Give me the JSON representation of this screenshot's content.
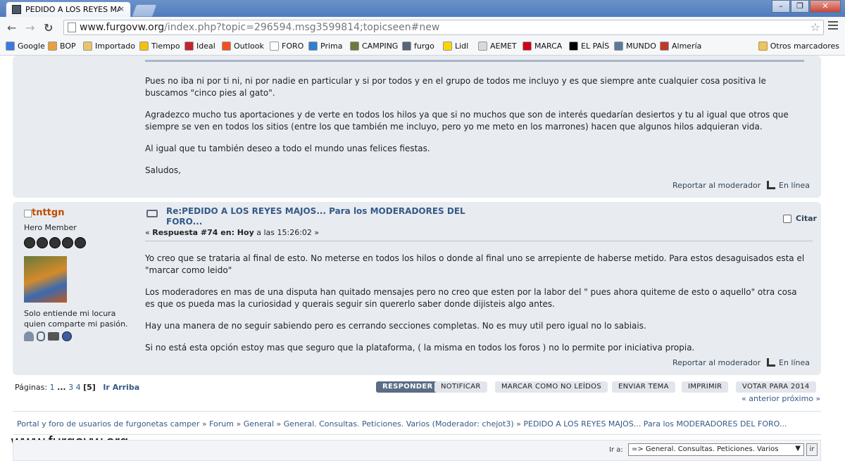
{
  "browser": {
    "tab_title": "PEDIDO A LOS REYES MAJOS...",
    "tab_close": "×",
    "url_main": "www.furgovw.org",
    "url_rest": "/index.php?topic=296594.msg3599814;topicseen#new",
    "star": "☆",
    "back": "←",
    "forward": "→",
    "reload": "↻",
    "win_min": "–",
    "win_max": "❐",
    "win_close": "✕"
  },
  "bookmarks": {
    "items": [
      {
        "label": "Google",
        "color": "#3b7ae0"
      },
      {
        "label": "BOP",
        "color": "#e9a23b"
      },
      {
        "label": "Importado",
        "color": "#e9c46a"
      },
      {
        "label": "Tiempo",
        "color": "#f4c20d"
      },
      {
        "label": "Ideal",
        "color": "#c0262d"
      },
      {
        "label": "Outlook",
        "color": "#f25022"
      },
      {
        "label": "FORO",
        "color": "#ffffff"
      },
      {
        "label": "Prima",
        "color": "#2f7fd1"
      },
      {
        "label": "CAMPING",
        "color": "#6a7a3a"
      },
      {
        "label": "furgo",
        "color": "#556677"
      },
      {
        "label": "Lidl",
        "color": "#ffd400"
      },
      {
        "label": "AEMET",
        "color": "#d9d9d9"
      },
      {
        "label": "MARCA",
        "color": "#d0021b"
      },
      {
        "label": "EL PAÍS",
        "color": "#000000"
      },
      {
        "label": "MUNDO",
        "color": "#5b7a9a"
      },
      {
        "label": "Almería",
        "color": "#c0392b"
      }
    ],
    "other": "Otros marcadores"
  },
  "post1": {
    "paragraphs": [
      "Pues no iba ni por ti ni, ni por nadie en particular y si por todos y en el grupo de todos me incluyo y es que siempre ante cualquier cosa positiva le buscamos \"cinco pies al gato\".",
      "Agradezco mucho tus aportaciones y de verte en todos los hilos ya que si no muchos que son de interés quedarían desiertos y tu al igual que otros que siempre se ven en todos los sitios (entre los que también me incluyo, pero yo me meto en los marrones) hacen que algunos hilos adquieran vida.",
      "Al igual que tu también deseo a todo el mundo unas felices fiestas.",
      "Saludos,"
    ],
    "report": "Reportar al moderador",
    "online": "En línea"
  },
  "post2": {
    "username": "tnttgn",
    "rank": "Hero Member",
    "signature_line1": "Solo entiende mi locura",
    "signature_line2": "quien comparte mi pasión.",
    "subject": "Re:PEDIDO A LOS REYES MAJOS... Para los MODERADORES DEL FORO...",
    "reply_prefix": "« ",
    "reply_bold": "Respuesta #74 en: Hoy",
    "reply_rest": " a las 15:26:02 »",
    "quote": "Citar",
    "paragraphs": [
      "Yo creo que se trataria al final de esto. No meterse en todos los hilos o donde al final uno se arrepiente de haberse metido. Para estos desaguisados esta el \"marcar como leido\"",
      "Los moderadores en mas de una disputa han quitado mensajes pero no creo que esten por la labor del \" pues ahora quiteme de esto o aquello\"  otra cosa es que os pueda mas la curiosidad y querais seguir sin quererlo saber donde dijisteis algo antes.",
      "Hay una manera de no seguir sabiendo pero es cerrando secciones completas. No es muy util pero igual no lo sabiais.",
      "Si no está esta opción estoy mas que seguro que la plataforma, ( la misma en todos los foros ) no lo permite por iniciativa propia."
    ],
    "report": "Reportar al moderador",
    "online": "En línea"
  },
  "pagination": {
    "label": "Páginas:",
    "p1": "1",
    "dots": "...",
    "p3": "3",
    "p4": "4",
    "current": "[5]",
    "top": "Ir Arriba"
  },
  "buttons": [
    "RESPONDER",
    "NOTIFICAR",
    "MARCAR COMO NO LEÍDOS",
    "ENVIAR TEMA",
    "IMPRIMIR",
    "VOTAR PARA 2014"
  ],
  "prevnext": {
    "prev": "« anterior",
    "next": "próximo »"
  },
  "breadcrumb": [
    "Portal y foro de usuarios de furgonetas camper",
    "Forum",
    "General",
    "General. Consultas. Peticiones. Varios (Moderador: chejot3)",
    "PEDIDO A LOS REYES MAJOS... Para los MODERADORES DEL FORO..."
  ],
  "breadcrumb_sep": " » ",
  "watermark": "www.furgovw.org",
  "jump": {
    "label": "Ir a:",
    "selected": "=> General. Consultas. Peticiones. Varios",
    "go": "ir"
  }
}
